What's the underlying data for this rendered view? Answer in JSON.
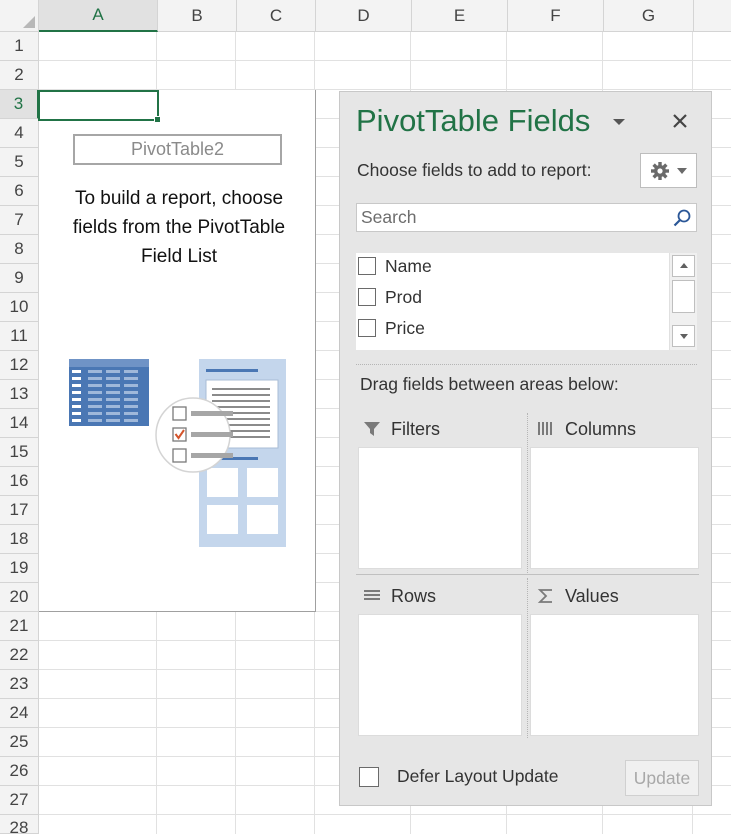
{
  "columns": [
    "A",
    "B",
    "C",
    "D",
    "E",
    "F",
    "G"
  ],
  "rows": [
    "1",
    "2",
    "3",
    "4",
    "5",
    "6",
    "7",
    "8",
    "9",
    "10",
    "11",
    "12",
    "13",
    "14",
    "15",
    "16",
    "17",
    "18",
    "19",
    "20",
    "21",
    "22",
    "23",
    "24",
    "25",
    "26",
    "27",
    "28"
  ],
  "selected": {
    "column": "A",
    "row": "3"
  },
  "pivot_placeholder": {
    "name": "PivotTable2",
    "message": "To build a report, choose\nfields from the PivotTable\nField List"
  },
  "field_list": {
    "title": "PivotTable Fields",
    "choose_label": "Choose fields to add to report:",
    "search_placeholder": "Search",
    "fields": [
      {
        "label": "Name",
        "checked": false
      },
      {
        "label": "Prod",
        "checked": false
      },
      {
        "label": "Price",
        "checked": false
      }
    ],
    "drag_label": "Drag fields between areas below:",
    "areas": {
      "filters": "Filters",
      "columns": "Columns",
      "rows": "Rows",
      "values": "Values"
    },
    "defer_label": "Defer Layout Update",
    "update_label": "Update"
  },
  "icons": {
    "pane_dropdown": "chevron-down-icon",
    "close": "close-icon",
    "tools": "gear-icon",
    "search": "search-icon",
    "filters": "filter-icon",
    "columns": "columns-icon",
    "rows": "rows-icon",
    "values": "sigma-icon"
  },
  "colors": {
    "accent": "#217346",
    "pane_bg": "#e6e6e6",
    "illustration_blue": "#4a77b4"
  }
}
